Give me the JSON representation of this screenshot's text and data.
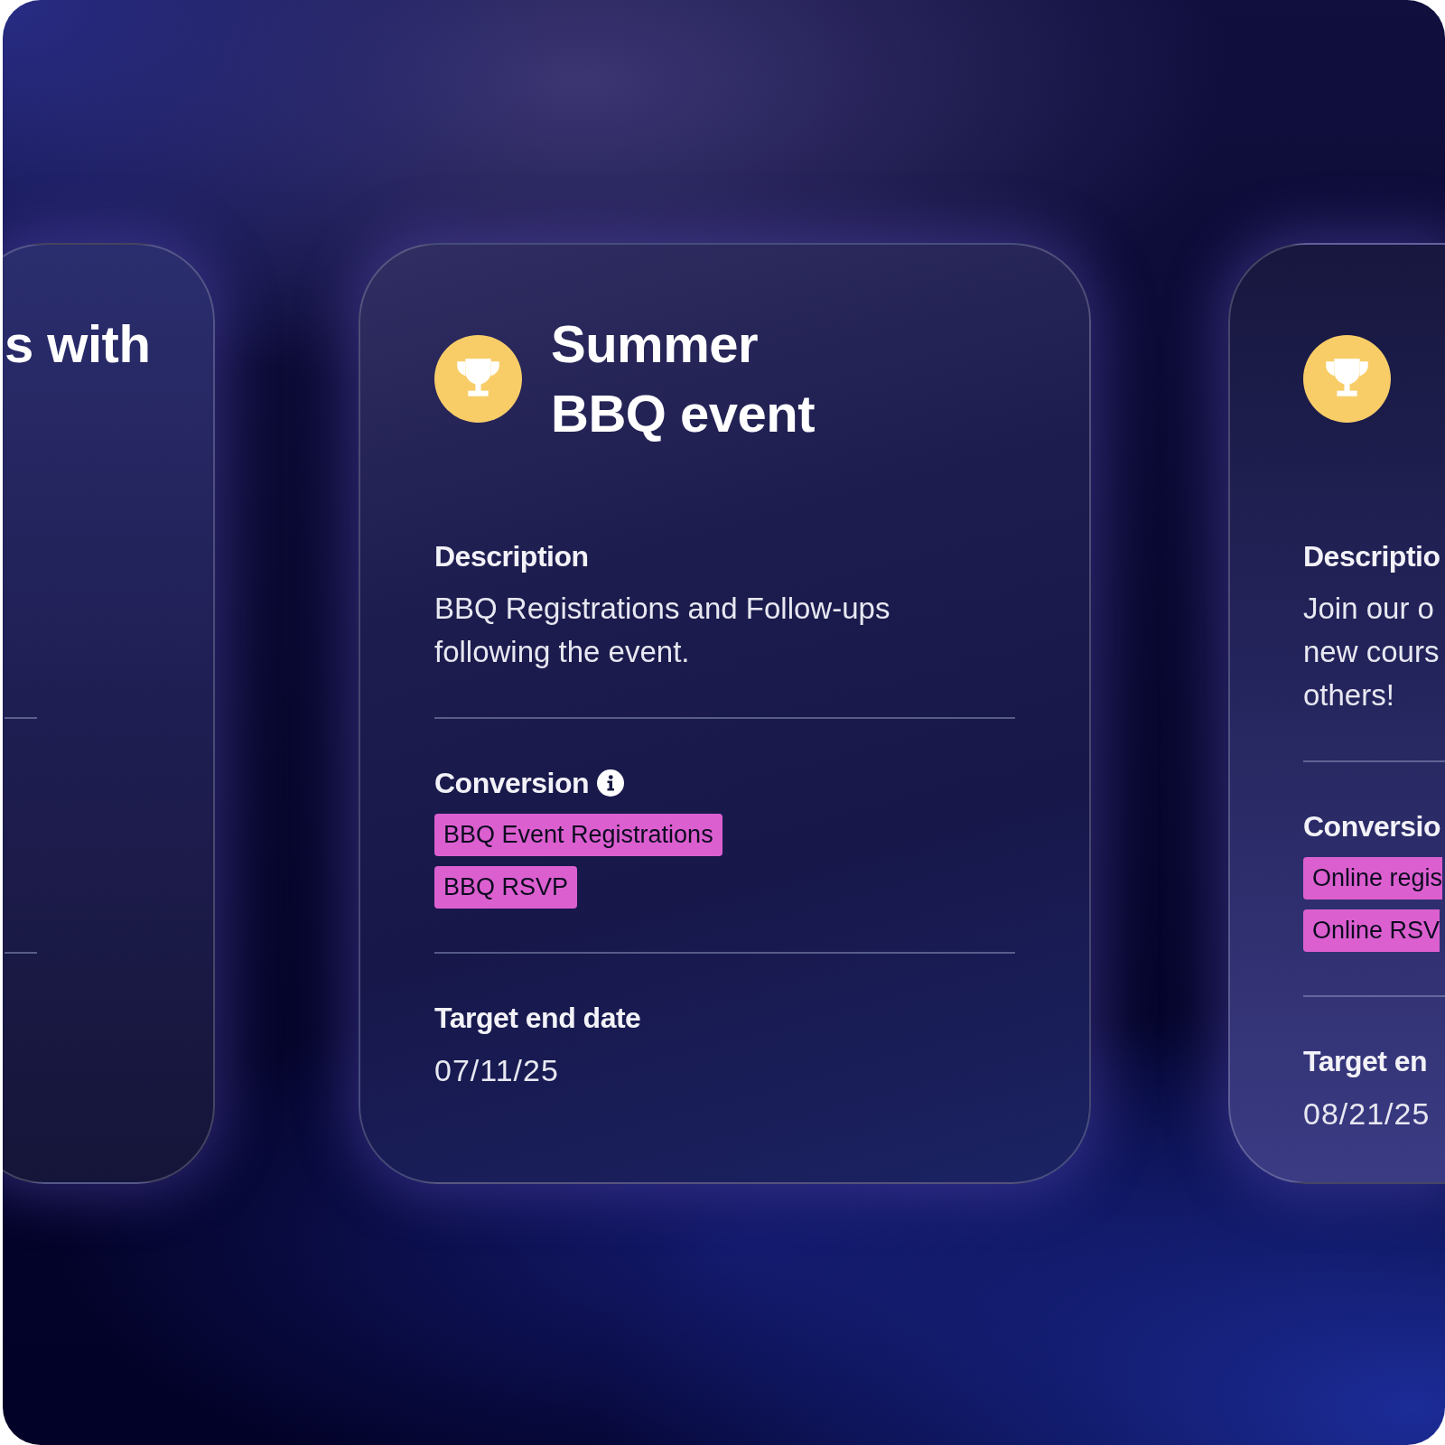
{
  "cards": [
    {
      "title": "s with"
    },
    {
      "title": "Summer BBQ event",
      "sections": [
        {
          "kind": "text",
          "label": "Description",
          "lines": [
            "BBQ Registrations and Follow-ups",
            "following the event."
          ]
        },
        {
          "kind": "tags",
          "label": "Conversion",
          "info": true,
          "tags": [
            "BBQ Event Registrations",
            "BBQ RSVP"
          ]
        },
        {
          "kind": "date",
          "label": "Target end date",
          "value": "07/11/25"
        }
      ]
    },
    {
      "sections": [
        {
          "kind": "text",
          "label": "Descriptio",
          "lines": [
            "Join our o",
            "new cours",
            "others!"
          ]
        },
        {
          "kind": "tags",
          "label": "Conversio",
          "tags": [
            "Online regis",
            "Online RSV"
          ]
        },
        {
          "kind": "date",
          "label": "Target en",
          "value": "08/21/25"
        }
      ]
    }
  ]
}
